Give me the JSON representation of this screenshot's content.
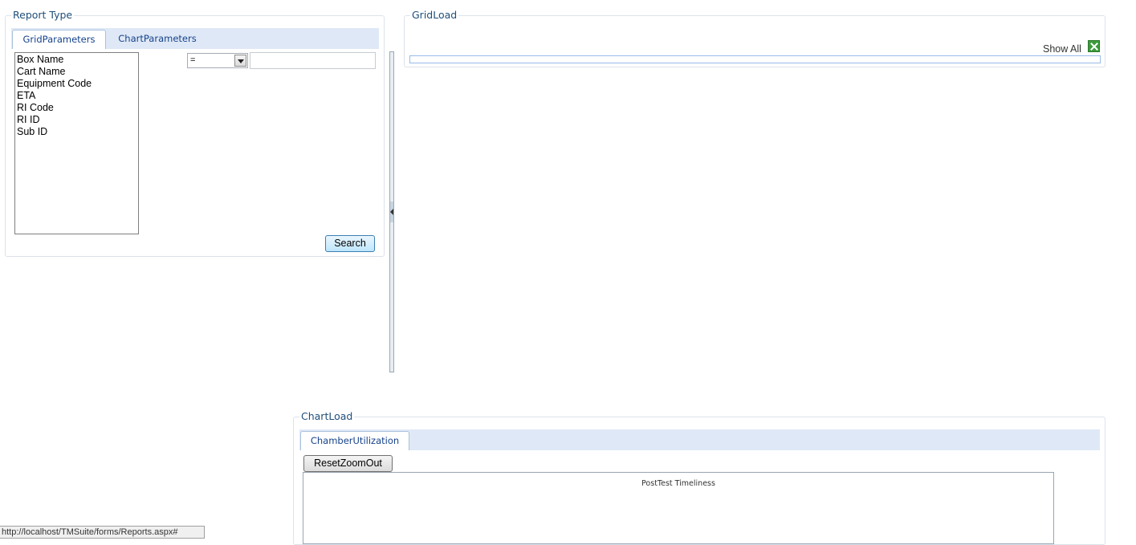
{
  "report_type": {
    "legend": "Report Type",
    "tabs": [
      {
        "label": "GridParameters",
        "active": true
      },
      {
        "label": "ChartParameters",
        "active": false
      }
    ],
    "fields": [
      "Box Name",
      "Cart Name",
      "Equipment Code",
      "ETA",
      "RI Code",
      "RI ID",
      "Sub ID"
    ],
    "operator": "=",
    "value": "",
    "search_label": "Search"
  },
  "grid_load": {
    "legend": "GridLoad",
    "show_all_label": "Show All",
    "export_icon": "excel-icon"
  },
  "chart_load": {
    "legend": "ChartLoad",
    "tabs": [
      {
        "label": "ChamberUtilization",
        "active": true
      }
    ],
    "reset_zoom_label": "ResetZoomOut",
    "chart_title": "PostTest Timeliness"
  },
  "status": {
    "url": "http://localhost/TMSuite/forms/Reports.aspx#"
  }
}
